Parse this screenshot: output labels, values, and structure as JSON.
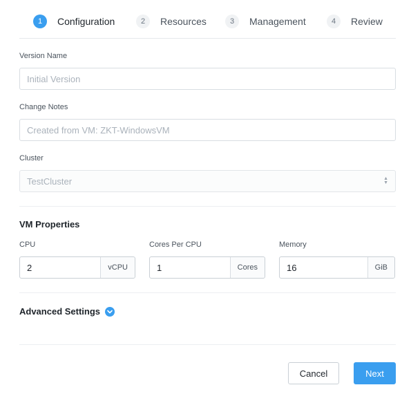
{
  "wizard": {
    "steps": [
      {
        "number": "1",
        "label": "Configuration"
      },
      {
        "number": "2",
        "label": "Resources"
      },
      {
        "number": "3",
        "label": "Management"
      },
      {
        "number": "4",
        "label": "Review"
      }
    ],
    "active_step": 0
  },
  "form": {
    "version_name": {
      "label": "Version Name",
      "value": "",
      "placeholder": "Initial Version"
    },
    "change_notes": {
      "label": "Change Notes",
      "value": "",
      "placeholder": "Created from VM: ZKT-WindowsVM"
    },
    "cluster": {
      "label": "Cluster",
      "value": "TestCluster"
    }
  },
  "vm_properties": {
    "title": "VM Properties",
    "cpu": {
      "label": "CPU",
      "value": "2",
      "unit": "vCPU"
    },
    "cores_per_cpu": {
      "label": "Cores Per CPU",
      "value": "1",
      "unit": "Cores"
    },
    "memory": {
      "label": "Memory",
      "value": "16",
      "unit": "GiB"
    }
  },
  "advanced": {
    "label": "Advanced Settings",
    "icon": "chevron-down-icon"
  },
  "footer": {
    "cancel_label": "Cancel",
    "next_label": "Next"
  },
  "colors": {
    "accent": "#3a9eef",
    "border": "#d8dde2",
    "text": "#22272e"
  }
}
